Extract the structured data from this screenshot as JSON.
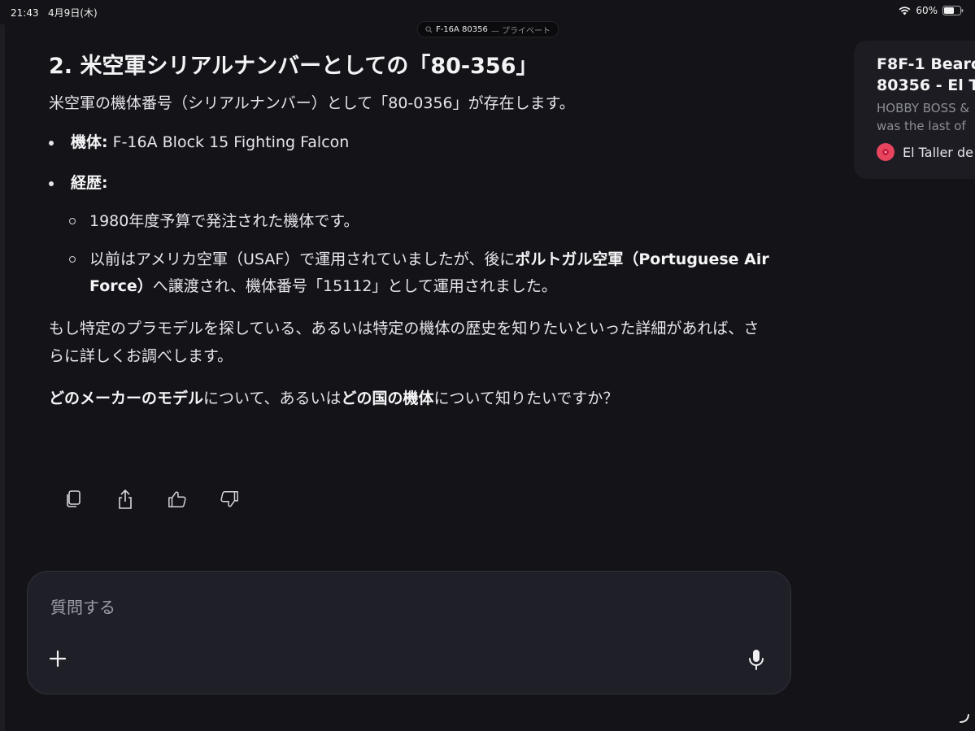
{
  "status": {
    "time": "21:43",
    "date": "4月9日(木)",
    "battery": "60%"
  },
  "tab": {
    "title": "F-16A 80356",
    "mode": "— プライベート"
  },
  "article": {
    "heading": "2. 米空軍シリアルナンバーとしての「80-356」",
    "intro": "米空軍の機体番号（シリアルナンバー）として「80-0356」が存在します。",
    "airframe_label": "機体:",
    "airframe_value": " F-16A Block 15 Fighting Falcon",
    "history_label": "経歴:",
    "history_1": "1980年度予算で発注された機体です。",
    "history_2_pre": "以前はアメリカ空軍（USAF）で運用されていましたが、後に",
    "history_2_bold": "ポルトガル空軍（Portuguese Air Force）",
    "history_2_post": "へ譲渡され、機体番号「15112」として運用されました。",
    "followup": "もし特定のプラモデルを探している、あるいは特定の機体の歴史を知りたいといった詳細があれば、さらに詳しくお調べします。",
    "q_bold_1": "どのメーカーのモデル",
    "q_mid": "について、あるいは",
    "q_bold_2": "どの国の機体",
    "q_end": "について知りたいですか？"
  },
  "composer": {
    "placeholder": "質問する"
  },
  "source_card": {
    "title_line1": "F8F-1 Bearc",
    "title_line2": "80356 - El T",
    "desc_line1": "HOBBY BOSS &",
    "desc_line2": "was the last of",
    "source": "El Taller de"
  },
  "colors": {
    "background": "#131318",
    "text": "#e6e6ea",
    "card": "#1c1c22"
  }
}
